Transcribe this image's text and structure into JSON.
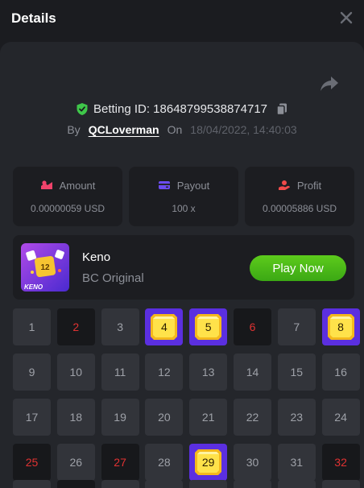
{
  "header": {
    "title": "Details",
    "close_icon": "close-icon"
  },
  "bet": {
    "id_text": "Betting ID: 18648799538874717",
    "by_label": "By",
    "user": "QCLoverman",
    "on_label": "On",
    "date": "18/04/2022, 14:40:03"
  },
  "stats": [
    {
      "label": "Amount",
      "value": "0.00000059 USD",
      "icon": "coins-icon",
      "color": "#f0436b"
    },
    {
      "label": "Payout",
      "value": "100 x",
      "icon": "wallet-icon",
      "color": "#6b4cf0"
    },
    {
      "label": "Profit",
      "value": "0.00005886 USD",
      "icon": "profit-icon",
      "color": "#f04a4a"
    }
  ],
  "game": {
    "name": "Keno",
    "provider": "BC Original",
    "play_label": "Play Now",
    "thumb_label": "KENO",
    "thumb_number": "12"
  },
  "grid": {
    "cells": [
      {
        "n": "1",
        "s": "normal"
      },
      {
        "n": "2",
        "s": "picked"
      },
      {
        "n": "3",
        "s": "normal"
      },
      {
        "n": "4",
        "s": "hit"
      },
      {
        "n": "5",
        "s": "hit"
      },
      {
        "n": "6",
        "s": "picked"
      },
      {
        "n": "7",
        "s": "normal"
      },
      {
        "n": "8",
        "s": "hit"
      },
      {
        "n": "9",
        "s": "normal"
      },
      {
        "n": "10",
        "s": "normal"
      },
      {
        "n": "11",
        "s": "normal"
      },
      {
        "n": "12",
        "s": "normal"
      },
      {
        "n": "13",
        "s": "normal"
      },
      {
        "n": "14",
        "s": "normal"
      },
      {
        "n": "15",
        "s": "normal"
      },
      {
        "n": "16",
        "s": "normal"
      },
      {
        "n": "17",
        "s": "normal"
      },
      {
        "n": "18",
        "s": "normal"
      },
      {
        "n": "19",
        "s": "normal"
      },
      {
        "n": "20",
        "s": "normal"
      },
      {
        "n": "21",
        "s": "normal"
      },
      {
        "n": "22",
        "s": "normal"
      },
      {
        "n": "23",
        "s": "normal"
      },
      {
        "n": "24",
        "s": "normal"
      },
      {
        "n": "25",
        "s": "picked"
      },
      {
        "n": "26",
        "s": "normal"
      },
      {
        "n": "27",
        "s": "picked"
      },
      {
        "n": "28",
        "s": "normal"
      },
      {
        "n": "29",
        "s": "hit"
      },
      {
        "n": "30",
        "s": "normal"
      },
      {
        "n": "31",
        "s": "normal"
      },
      {
        "n": "32",
        "s": "picked"
      }
    ]
  },
  "colors": {
    "accent_green": "#4cbb17",
    "hit_purple": "#5b2fe0",
    "picked_red": "#e03232",
    "shield_green": "#3fc74a"
  }
}
